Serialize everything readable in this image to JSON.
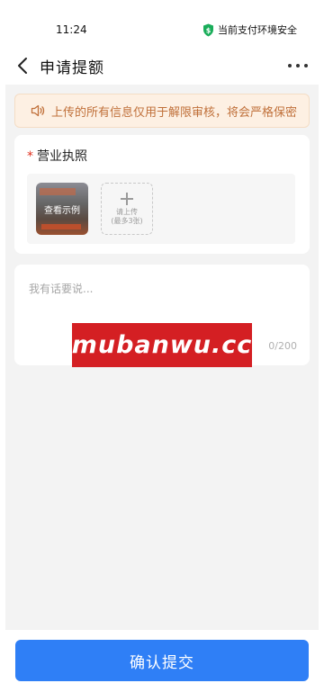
{
  "status_bar": {
    "time": "11:24",
    "security_text": "当前支付环境安全",
    "security_icon": "shield-check-icon",
    "security_color": "#1aad5a"
  },
  "nav": {
    "back_icon": "chevron-left-icon",
    "title": "申请提额",
    "more_icon": "more-dots-icon"
  },
  "notice": {
    "icon": "speaker-icon",
    "text": "上传的所有信息仅用于解限审核，将会严格保密"
  },
  "license": {
    "required_mark": "*",
    "label": "营业执照",
    "sample_label": "查看示例",
    "upload_line1": "请上传",
    "upload_line2": "(最多3张)"
  },
  "note": {
    "placeholder": "我有话要说...",
    "count": "0/200"
  },
  "watermark": {
    "text": "mubanwu.cc"
  },
  "footer": {
    "submit_label": "确认提交",
    "accent_color": "#2f7ff6"
  }
}
